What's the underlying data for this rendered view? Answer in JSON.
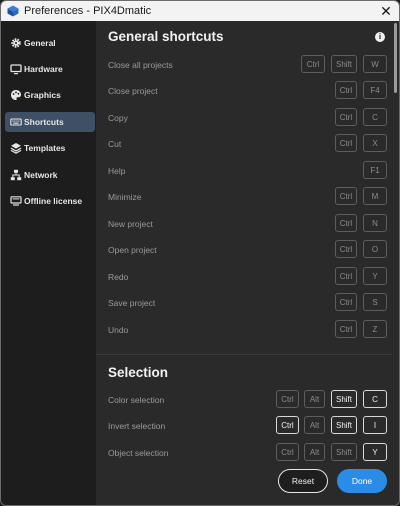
{
  "window": {
    "title": "Preferences - PIX4Dmatic",
    "close_glyph": "✕",
    "app_icon": "pix4d-logo-icon"
  },
  "sidebar": {
    "items": [
      {
        "label": "General",
        "icon": "gear-icon"
      },
      {
        "label": "Hardware",
        "icon": "monitor-icon"
      },
      {
        "label": "Graphics",
        "icon": "palette-icon"
      },
      {
        "label": "Shortcuts",
        "icon": "keyboard-icon",
        "active": true
      },
      {
        "label": "Templates",
        "icon": "layers-icon"
      },
      {
        "label": "Network",
        "icon": "network-icon"
      },
      {
        "label": "Offline license",
        "icon": "license-icon"
      }
    ]
  },
  "general": {
    "title": "General shortcuts",
    "info_glyph": "i",
    "rows": [
      {
        "label": "Close all projects",
        "keys": [
          "Ctrl",
          "Shift",
          "W"
        ]
      },
      {
        "label": "Close project",
        "keys": [
          "Ctrl",
          "F4"
        ]
      },
      {
        "label": "Copy",
        "keys": [
          "Ctrl",
          "C"
        ]
      },
      {
        "label": "Cut",
        "keys": [
          "Ctrl",
          "X"
        ]
      },
      {
        "label": "Help",
        "keys": [
          "F1"
        ]
      },
      {
        "label": "Minimize",
        "keys": [
          "Ctrl",
          "M"
        ]
      },
      {
        "label": "New project",
        "keys": [
          "Ctrl",
          "N"
        ]
      },
      {
        "label": "Open project",
        "keys": [
          "Ctrl",
          "O"
        ]
      },
      {
        "label": "Redo",
        "keys": [
          "Ctrl",
          "Y"
        ]
      },
      {
        "label": "Save project",
        "keys": [
          "Ctrl",
          "S"
        ]
      },
      {
        "label": "Undo",
        "keys": [
          "Ctrl",
          "Z"
        ]
      }
    ]
  },
  "selection": {
    "title": "Selection",
    "rows": [
      {
        "label": "Color selection",
        "keys": [
          "Ctrl",
          "Alt",
          "Shift",
          "C"
        ],
        "active": [
          false,
          false,
          true,
          true
        ]
      },
      {
        "label": "Invert selection",
        "keys": [
          "Ctrl",
          "Alt",
          "Shift",
          "I"
        ],
        "active": [
          true,
          false,
          true,
          true
        ]
      },
      {
        "label": "Object selection",
        "keys": [
          "Ctrl",
          "Alt",
          "Shift",
          "Y"
        ],
        "active": [
          false,
          false,
          false,
          true
        ]
      }
    ]
  },
  "footer": {
    "reset_label": "Reset",
    "done_label": "Done"
  }
}
